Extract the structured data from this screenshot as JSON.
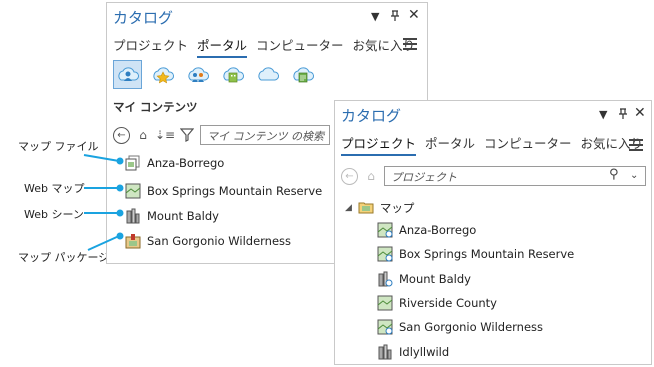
{
  "callouts": [
    "マップ ファイル",
    "Web マップ",
    "Web シーン",
    "マップ パッケージ"
  ],
  "panel1": {
    "title": "カタログ",
    "tabs": [
      "プロジェクト",
      "ポータル",
      "コンピューター",
      "お気に入り"
    ],
    "active_tab": "ポータル",
    "portal_icons": [
      "my-content-icon",
      "favorites-icon",
      "groups-icon",
      "organization-icon",
      "online-icon",
      "living-atlas-icon"
    ],
    "section": "マイ コンテンツ",
    "search_placeholder": "マイ コンテンツ の検索",
    "items": [
      "Anza-Borrego",
      "Box Springs Mountain Reserve",
      "Mount Baldy",
      "San Gorgonio Wilderness"
    ]
  },
  "panel2": {
    "title": "カタログ",
    "tabs": [
      "プロジェクト",
      "ポータル",
      "コンピューター",
      "お気に入り"
    ],
    "active_tab": "プロジェクト",
    "search_placeholder": "プロジェクト",
    "folder": "マップ",
    "items": [
      "Anza-Borrego",
      "Box Springs Mountain Reserve",
      "Mount Baldy",
      "Riverside County",
      "San Gorgonio Wilderness",
      "Idlyllwild"
    ]
  },
  "colors": {
    "accent": "#2b6db0",
    "callout_line": "#1aa3e0",
    "selected_bg": "#cfe3f5"
  }
}
